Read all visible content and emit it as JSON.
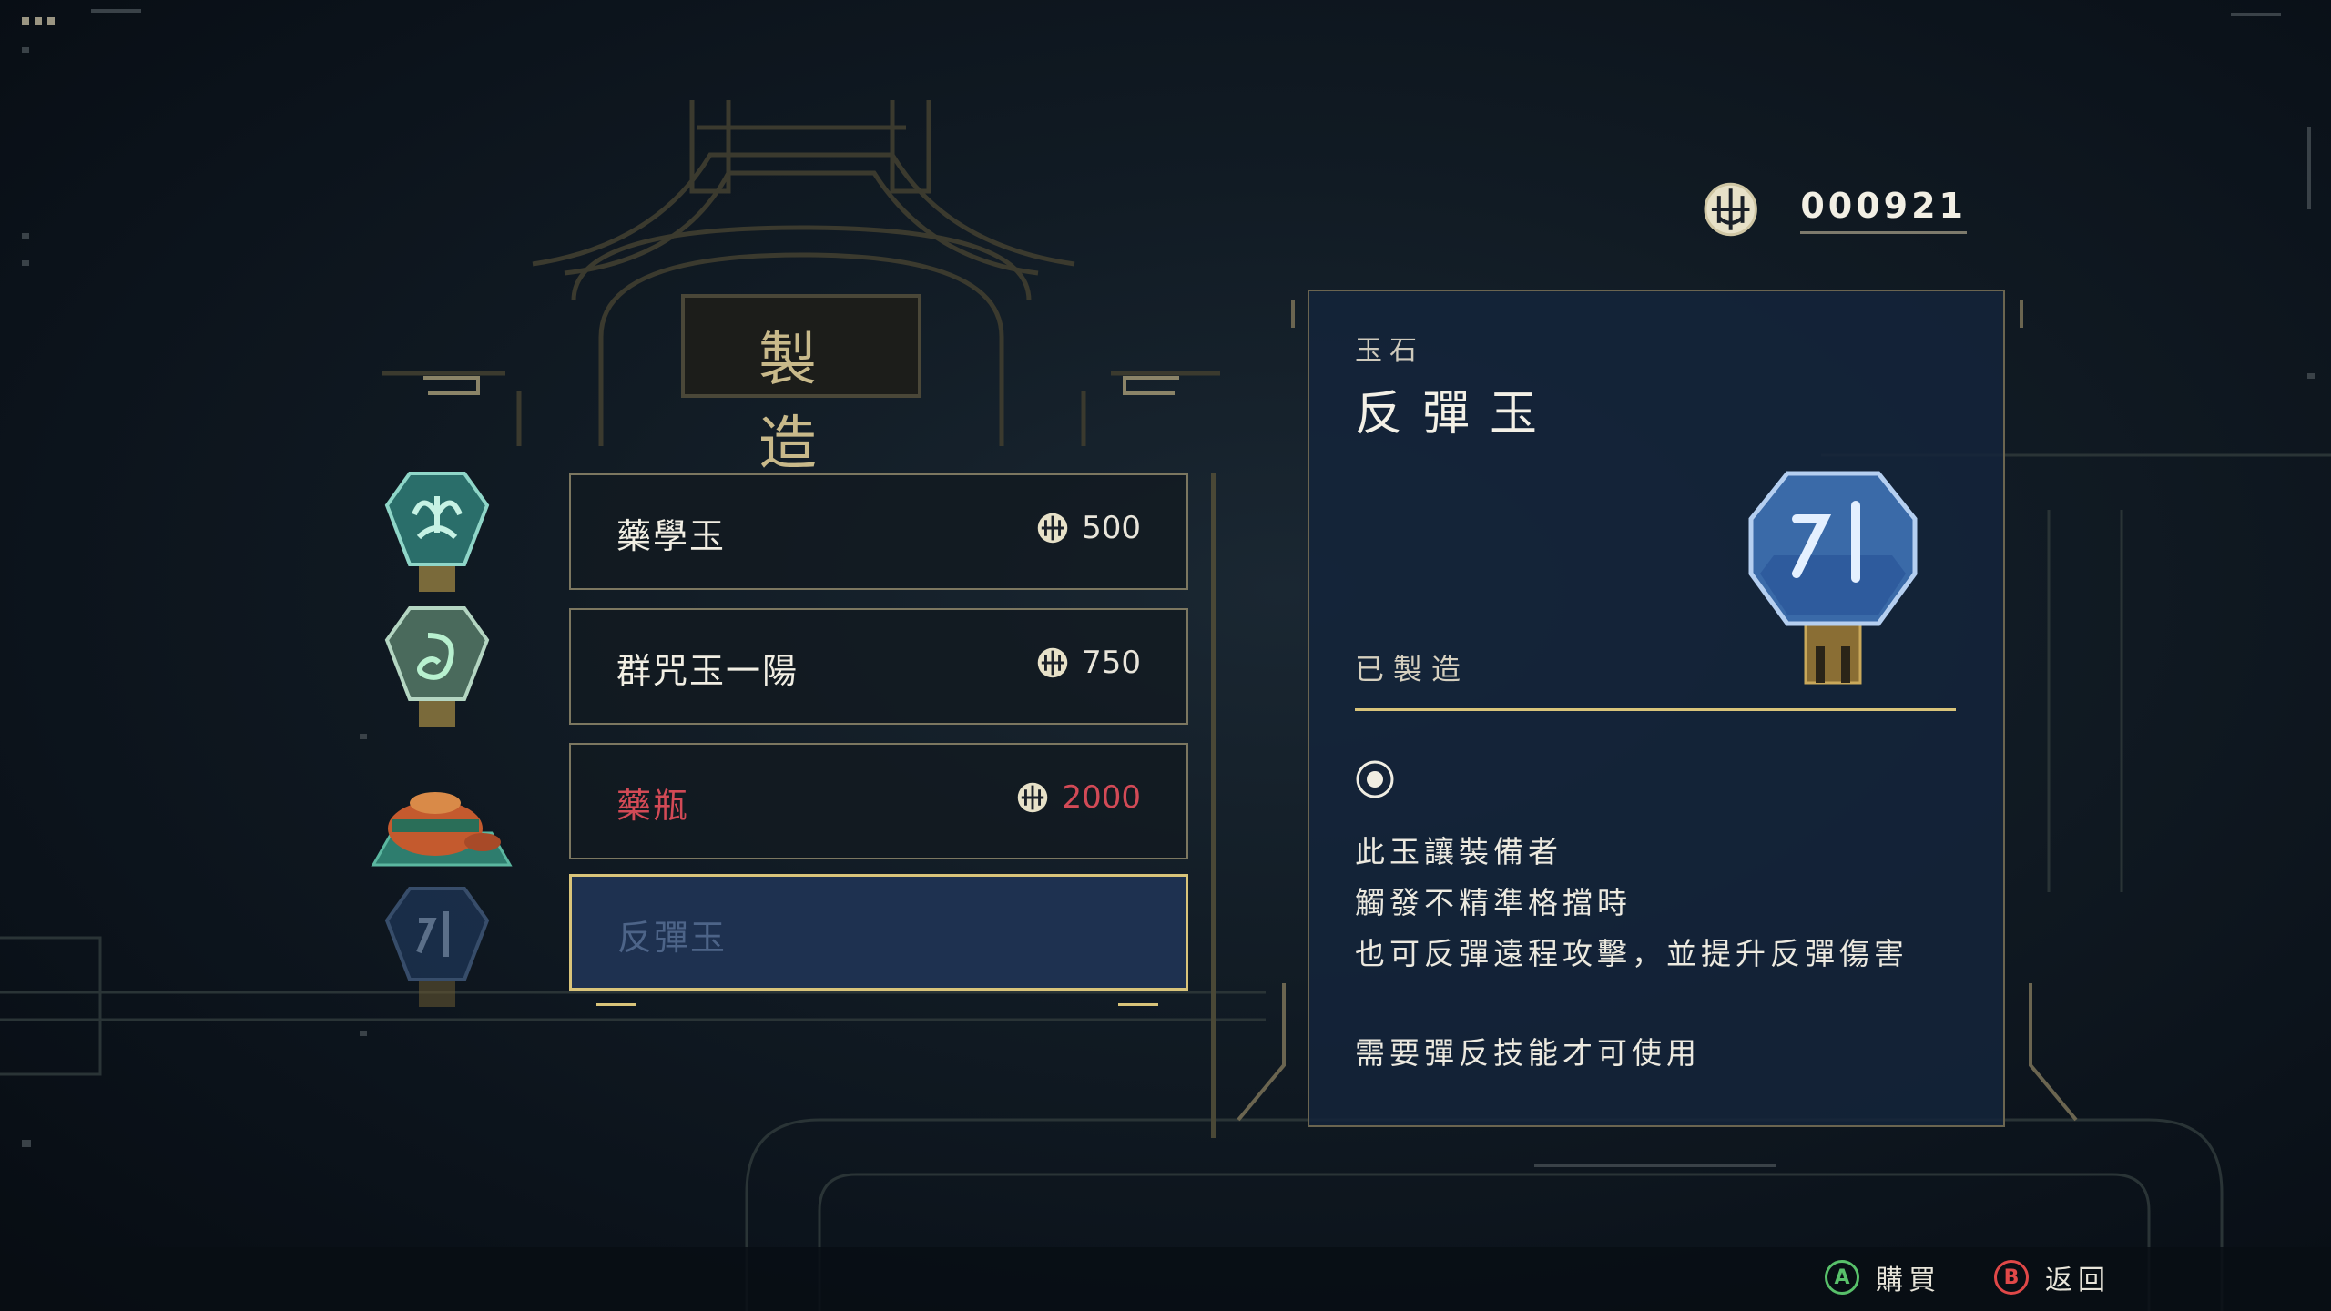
{
  "header": {
    "currency_icon": "jade-coin-icon",
    "currency_amount": "000921"
  },
  "title": "製造",
  "items": [
    {
      "name": "藥學玉",
      "price": "500",
      "icon": "jade-medicine-icon",
      "state": "normal"
    },
    {
      "name": "群咒玉一陽",
      "price": "750",
      "icon": "jade-swirl-icon",
      "state": "normal"
    },
    {
      "name": "藥瓶",
      "price": "2000",
      "icon": "medicine-pot-icon",
      "state": "unaffordable"
    },
    {
      "name": "反彈玉",
      "price": "",
      "icon": "jade-reflect-icon",
      "state": "selected"
    }
  ],
  "detail": {
    "category": "玉石",
    "title": "反彈玉",
    "status": "已製造",
    "description_lines": [
      "此玉讓裝備者",
      "觸發不精準格擋時",
      "也可反彈遠程攻擊，並提升反彈傷害"
    ],
    "requirement": "需要彈反技能才可使用"
  },
  "footer": {
    "buy_button": "A",
    "buy_label": "購買",
    "back_button": "B",
    "back_label": "返回"
  },
  "colors": {
    "accent_gold": "#d9c47a",
    "unaffordable_red": "#d24a56",
    "panel_blue": "#14243a",
    "a_button_green": "#58c06a",
    "b_button_red": "#e04848"
  }
}
